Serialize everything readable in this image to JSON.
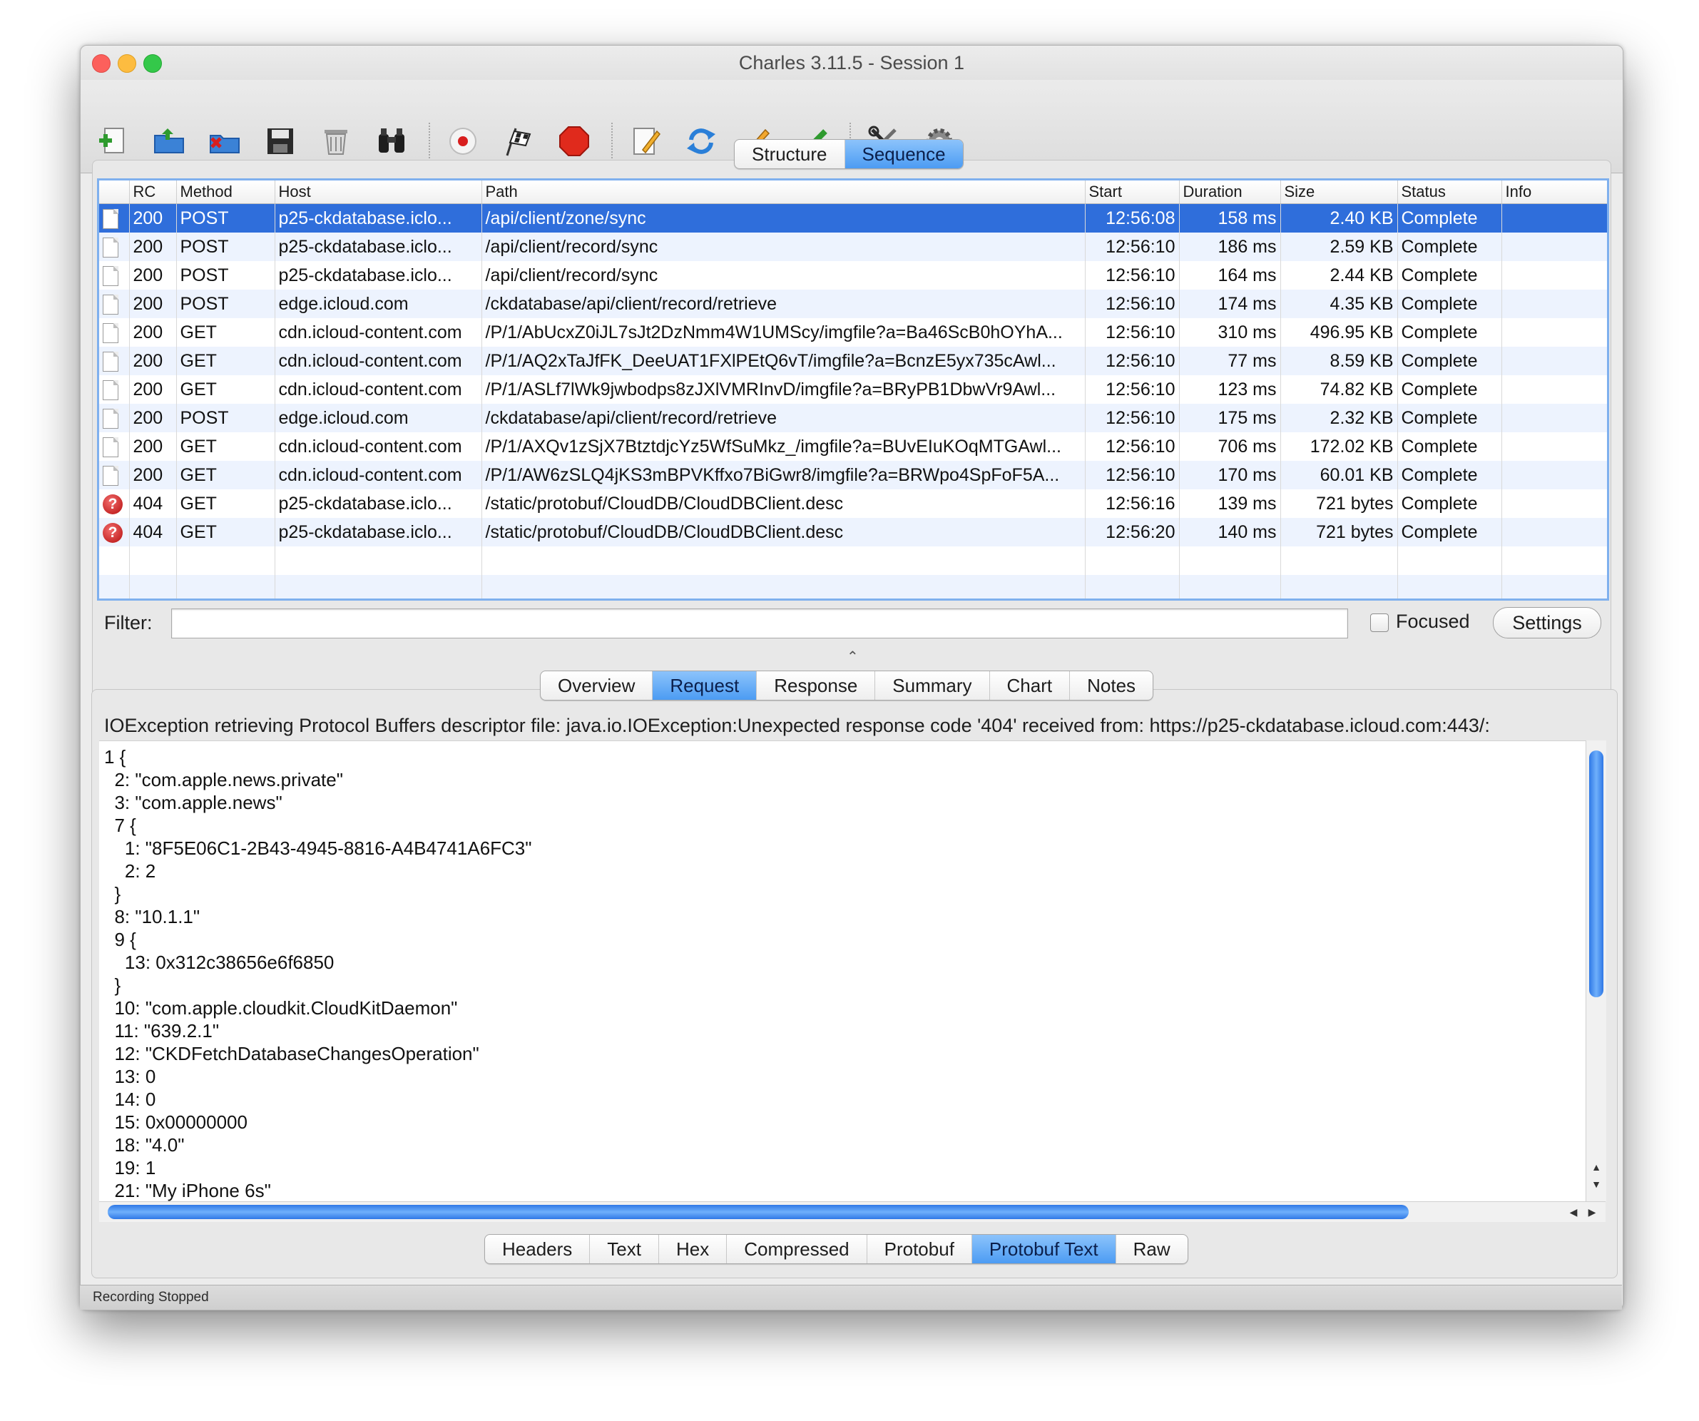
{
  "window": {
    "title": "Charles 3.11.5 - Session 1"
  },
  "toolbar": {
    "icons": [
      "new-session-icon",
      "open-folder-icon",
      "close-session-icon",
      "save-icon",
      "trash-icon",
      "find-binoculars-icon",
      "record-icon",
      "throttle-flag-icon",
      "stop-icon",
      "compose-icon",
      "repeat-icon",
      "edit-pencil-icon",
      "validate-check-icon",
      "tools-icon",
      "settings-gear-icon"
    ]
  },
  "view_tabs": [
    "Structure",
    "Sequence"
  ],
  "view_active": "Sequence",
  "table": {
    "columns": [
      "",
      "RC",
      "Method",
      "Host",
      "Path",
      "Start",
      "Duration",
      "Size",
      "Status",
      "Info"
    ],
    "rows": [
      {
        "icon": "document",
        "rc": "200",
        "method": "POST",
        "host": "p25-ckdatabase.iclo...",
        "path": "/api/client/zone/sync",
        "start": "12:56:08",
        "duration": "158 ms",
        "size": "2.40 KB",
        "status": "Complete",
        "info": "",
        "selected": true
      },
      {
        "icon": "document",
        "rc": "200",
        "method": "POST",
        "host": "p25-ckdatabase.iclo...",
        "path": "/api/client/record/sync",
        "start": "12:56:10",
        "duration": "186 ms",
        "size": "2.59 KB",
        "status": "Complete",
        "info": ""
      },
      {
        "icon": "document",
        "rc": "200",
        "method": "POST",
        "host": "p25-ckdatabase.iclo...",
        "path": "/api/client/record/sync",
        "start": "12:56:10",
        "duration": "164 ms",
        "size": "2.44 KB",
        "status": "Complete",
        "info": ""
      },
      {
        "icon": "document",
        "rc": "200",
        "method": "POST",
        "host": "edge.icloud.com",
        "path": "/ckdatabase/api/client/record/retrieve",
        "start": "12:56:10",
        "duration": "174 ms",
        "size": "4.35 KB",
        "status": "Complete",
        "info": ""
      },
      {
        "icon": "document",
        "rc": "200",
        "method": "GET",
        "host": "cdn.icloud-content.com",
        "path": "/P/1/AbUcxZ0iJL7sJt2DzNmm4W1UMScy/imgfile?a=Ba46ScB0hOYhA...",
        "start": "12:56:10",
        "duration": "310 ms",
        "size": "496.95 KB",
        "status": "Complete",
        "info": ""
      },
      {
        "icon": "document",
        "rc": "200",
        "method": "GET",
        "host": "cdn.icloud-content.com",
        "path": "/P/1/AQ2xTaJfFK_DeeUAT1FXlPEtQ6vT/imgfile?a=BcnzE5yx735cAwl...",
        "start": "12:56:10",
        "duration": "77 ms",
        "size": "8.59 KB",
        "status": "Complete",
        "info": ""
      },
      {
        "icon": "document",
        "rc": "200",
        "method": "GET",
        "host": "cdn.icloud-content.com",
        "path": "/P/1/ASLf7lWk9jwbodps8zJXlVMRInvD/imgfile?a=BRyPB1DbwVr9Awl...",
        "start": "12:56:10",
        "duration": "123 ms",
        "size": "74.82 KB",
        "status": "Complete",
        "info": ""
      },
      {
        "icon": "document",
        "rc": "200",
        "method": "POST",
        "host": "edge.icloud.com",
        "path": "/ckdatabase/api/client/record/retrieve",
        "start": "12:56:10",
        "duration": "175 ms",
        "size": "2.32 KB",
        "status": "Complete",
        "info": ""
      },
      {
        "icon": "document",
        "rc": "200",
        "method": "GET",
        "host": "cdn.icloud-content.com",
        "path": "/P/1/AXQv1zSjX7BtztdjcYz5WfSuMkz_/imgfile?a=BUvEIuKOqMTGAwl...",
        "start": "12:56:10",
        "duration": "706 ms",
        "size": "172.02 KB",
        "status": "Complete",
        "info": ""
      },
      {
        "icon": "document",
        "rc": "200",
        "method": "GET",
        "host": "cdn.icloud-content.com",
        "path": "/P/1/AW6zSLQ4jKS3mBPVKffxo7BiGwr8/imgfile?a=BRWpo4SpFoF5A...",
        "start": "12:56:10",
        "duration": "170 ms",
        "size": "60.01 KB",
        "status": "Complete",
        "info": ""
      },
      {
        "icon": "error",
        "rc": "404",
        "method": "GET",
        "host": "p25-ckdatabase.iclo...",
        "path": "/static/protobuf/CloudDB/CloudDBClient.desc",
        "start": "12:56:16",
        "duration": "139 ms",
        "size": "721 bytes",
        "status": "Complete",
        "info": ""
      },
      {
        "icon": "error",
        "rc": "404",
        "method": "GET",
        "host": "p25-ckdatabase.iclo...",
        "path": "/static/protobuf/CloudDB/CloudDBClient.desc",
        "start": "12:56:20",
        "duration": "140 ms",
        "size": "721 bytes",
        "status": "Complete",
        "info": ""
      }
    ]
  },
  "filter": {
    "label": "Filter:",
    "value": "",
    "placeholder": ""
  },
  "focused": {
    "label": "Focused",
    "checked": false
  },
  "settings_button": "Settings",
  "detail_tabs": [
    "Overview",
    "Request",
    "Response",
    "Summary",
    "Chart",
    "Notes"
  ],
  "detail_active": "Request",
  "error_message": "IOException retrieving Protocol Buffers descriptor file: java.io.IOException:Unexpected response code '404' received from: https://p25-ckdatabase.icloud.com:443/:",
  "protobuf_lines": [
    "1 {",
    "  2: \"com.apple.news.private\"",
    "  3: \"com.apple.news\"",
    "  7 {",
    "    1: \"8F5E06C1-2B43-4945-8816-A4B4741A6FC3\"",
    "    2: 2",
    "  }",
    "  8: \"10.1.1\"",
    "  9 {",
    "    13: 0x312c38656e6f6850",
    "  }",
    "  10: \"com.apple.cloudkit.CloudKitDaemon\"",
    "  11: \"639.2.1\"",
    "  12: \"CKDFetchDatabaseChangesOperation\"",
    "  13: 0",
    "  14: 0",
    "  15: 0x00000000",
    "  18: \"4.0\"",
    "  19: 1",
    "  21: \"My iPhone 6s\""
  ],
  "format_tabs": [
    "Headers",
    "Text",
    "Hex",
    "Compressed",
    "Protobuf",
    "Protobuf Text",
    "Raw"
  ],
  "format_active": "Protobuf Text",
  "status_bar": "Recording Stopped",
  "colors": {
    "selection": "#2f6edb",
    "tab_active": "#4c9cf3",
    "stripe": "#edf3fe",
    "error": "#c81414"
  }
}
